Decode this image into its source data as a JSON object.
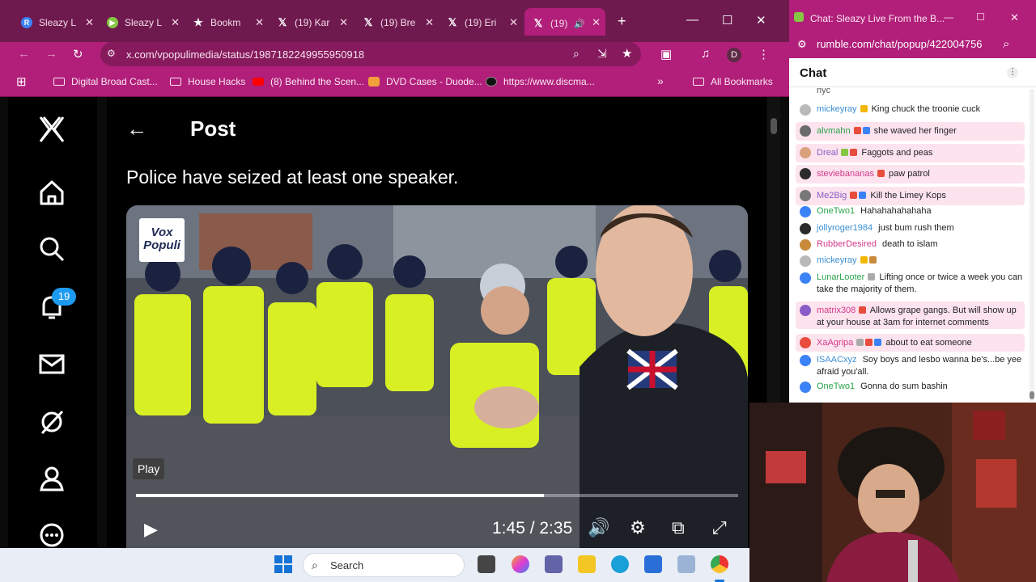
{
  "browser": {
    "tabs": [
      {
        "label": "Sleazy L",
        "icon": "rumble-r-icon",
        "color": "#3b82f6"
      },
      {
        "label": "Sleazy L",
        "icon": "rumble-play-icon",
        "color": "#85c742"
      },
      {
        "label": "Bookm",
        "icon": "star-icon",
        "color": "#ffffff"
      },
      {
        "label": "(19) Kar",
        "icon": "x-logo-icon",
        "color": "#ffffff"
      },
      {
        "label": "(19) Bre",
        "icon": "x-logo-icon",
        "color": "#ffffff"
      },
      {
        "label": "(19) Eri",
        "icon": "x-logo-icon",
        "color": "#ffffff"
      },
      {
        "label": "(19)",
        "icon": "x-logo-icon",
        "color": "#ffffff",
        "active": true
      }
    ],
    "url": "x.com/vpopulimedia/status/1987182249955950918",
    "profile_letter": "D",
    "bookmarks": [
      {
        "label": "Digital Broad Cast...",
        "icon": "folder-icon"
      },
      {
        "label": "House Hacks",
        "icon": "folder-icon"
      },
      {
        "label": "(8) Behind the Scen...",
        "icon": "youtube-icon"
      },
      {
        "label": "DVD Cases - Duode...",
        "icon": "dvd-icon"
      },
      {
        "label": "https://www.discma...",
        "icon": "discmakers-icon"
      }
    ],
    "all_bookmarks_label": "All Bookmarks",
    "overflow_label": "»"
  },
  "x_sidebar": {
    "notification_count": "19"
  },
  "post": {
    "title": "Post",
    "text": "Police have seized at least one speaker.",
    "video": {
      "logo_text_1": "Vox",
      "logo_text_2": "Populi",
      "play_tooltip": "Play",
      "time": "1:45 / 2:35",
      "progress": 0.677
    }
  },
  "taskbar": {
    "search_label": "Search"
  },
  "chat": {
    "window_title": "Chat: Sleazy Live From the B...",
    "url": "rumble.com/chat/popup/422004756",
    "header": "Chat",
    "partial_top": "nyc",
    "messages": [
      {
        "user": "mickeyray",
        "user_color": "#3b8fd4",
        "badges": [
          "#f2b705"
        ],
        "text": "King chuck the troonie cuck",
        "av": "#b9b9b9",
        "hl": false
      },
      {
        "user": "alvmahn",
        "user_color": "#2aa34a",
        "badges": [
          "#e74c3c",
          "#3b82f6"
        ],
        "text": "she waved her finger",
        "av": "#6b6b6b",
        "hl": true
      },
      {
        "user": "Dreal",
        "user_color": "#8a5cc8",
        "badges": [
          "#85c742",
          "#e74c3c"
        ],
        "text": "Faggots and peas",
        "av": "#d9a07c",
        "hl": true
      },
      {
        "user": "steviebananas",
        "user_color": "#d4398b",
        "badges": [
          "#e74c3c"
        ],
        "text": "paw patrol",
        "av": "#2b2b2b",
        "hl": true
      },
      {
        "user": "Me2Big",
        "user_color": "#8a5cc8",
        "badges": [
          "#e74c3c",
          "#3b82f6"
        ],
        "text": "Kill the Limey Kops",
        "av": "#777777",
        "hl": true
      },
      {
        "user": "OneTwo1",
        "user_color": "#2aa34a",
        "badges": [],
        "text": "Hahahahahahaha",
        "av": "#3b82f6",
        "hl": false
      },
      {
        "user": "jollyroger1984",
        "user_color": "#3b8fd4",
        "badges": [],
        "text": "just bum rush them",
        "av": "#2b2b2b",
        "hl": false
      },
      {
        "user": "RubberDesired",
        "user_color": "#d4398b",
        "badges": [],
        "text": "death to islam",
        "av": "#c98a3c",
        "hl": false
      },
      {
        "user": "mickeyray",
        "user_color": "#3b8fd4",
        "badges": [
          "#f2b705",
          "#c98a3c"
        ],
        "text": "",
        "av": "#b9b9b9",
        "hl": false
      },
      {
        "user": "LunarLooter",
        "user_color": "#2aa34a",
        "badges": [
          "#aaaaaa"
        ],
        "text": "Lifting once or twice a week you can take the majority of them.",
        "av": "#3b82f6",
        "hl": false
      },
      {
        "user": "matrix308",
        "user_color": "#d4398b",
        "badges": [
          "#e74c3c"
        ],
        "text": "Allows grape gangs. But will show up at your house at 3am for internet comments",
        "av": "#8a5cc8",
        "hl": true
      },
      {
        "user": "XaAgripa",
        "user_color": "#d4398b",
        "badges": [
          "#aaaaaa",
          "#e74c3c",
          "#3b82f6"
        ],
        "text": "about to eat someone",
        "av": "#e74c3c",
        "hl": true
      },
      {
        "user": "ISAACxyz",
        "user_color": "#3b8fd4",
        "badges": [],
        "text": "Soy boys and lesbo wanna be's...be yee afraid you'all.",
        "av": "#3b82f6",
        "hl": false
      },
      {
        "user": "OneTwo1",
        "user_color": "#2aa34a",
        "badges": [],
        "text": "Gonna do sum bashin",
        "av": "#3b82f6",
        "hl": false
      }
    ]
  }
}
